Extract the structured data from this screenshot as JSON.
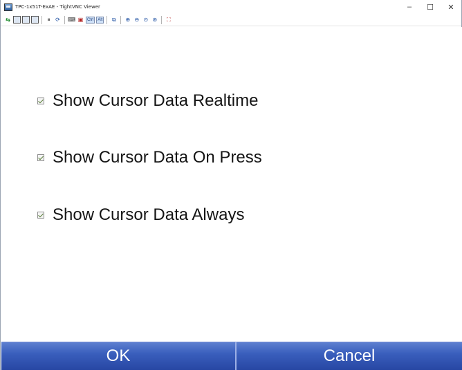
{
  "window": {
    "title": "TPC-1x51T-ExAE - TightVNC Viewer",
    "controls": {
      "minimize": "–",
      "maximize": "☐",
      "close": "✕"
    }
  },
  "toolbar": {
    "icons": [
      "new-connection-icon",
      "save-icon",
      "options-icon",
      "info-icon",
      "pause-icon",
      "refresh-icon",
      "ctrl-alt-del-icon",
      "ctrl-esc-icon",
      "ctrl-key-icon",
      "alt-key-icon",
      "transfer-icon",
      "zoom-in-icon",
      "zoom-out-icon",
      "zoom-100-icon",
      "zoom-fit-icon",
      "fullscreen-icon"
    ],
    "ctrl_label": "Ctrl",
    "alt_label": "Alt"
  },
  "options": [
    {
      "label": "Show Cursor Data Realtime",
      "checked": true
    },
    {
      "label": "Show Cursor Data On Press",
      "checked": true
    },
    {
      "label": "Show Cursor Data Always",
      "checked": true
    }
  ],
  "buttons": {
    "ok": "OK",
    "cancel": "Cancel"
  },
  "colors": {
    "button_blue": "#3a5fbd",
    "checkbox_mark": "#5a7f3a"
  }
}
